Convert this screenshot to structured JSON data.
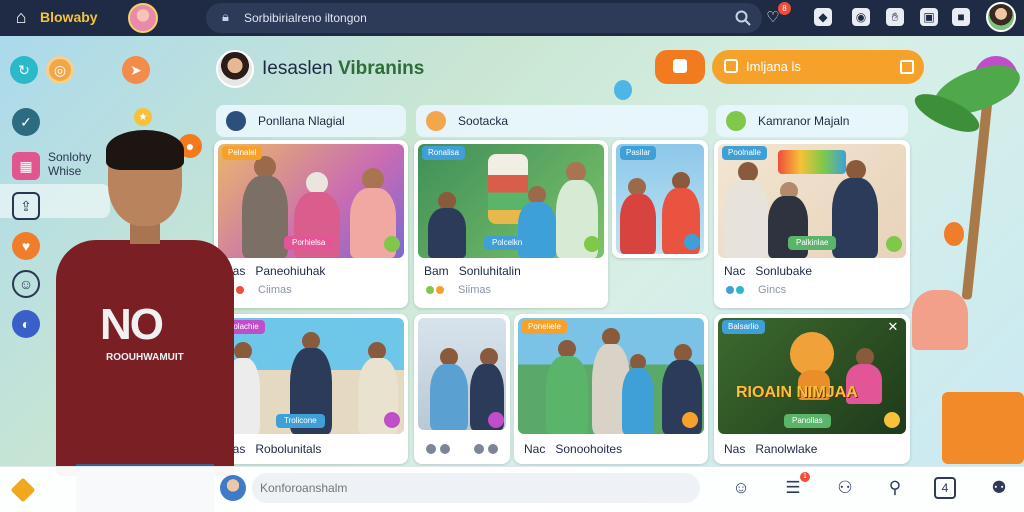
{
  "topbar": {
    "brand": "Blowaby",
    "search_text": "Sorbibirialreno iltongon",
    "notif_count": "8"
  },
  "sidebar": {
    "row_label": "Sonlohy Whise"
  },
  "main": {
    "title_plain": "Iesaslen",
    "title_highlight": "Vibranins",
    "pill_label": "Imljana ls"
  },
  "person": {
    "shirt_text": "NO",
    "shirt_sub": "ROOUHWAMUIT"
  },
  "columns": [
    {
      "label": "Ponllana Nlagial"
    },
    {
      "label": "Sootacka"
    },
    {
      "label": "Kamranor Majaln"
    }
  ],
  "cards": [
    {
      "tag": "Pelnalel",
      "ribbon": "Porhielsa",
      "t1a": "Nas",
      "t1b": "Paneohiuhak",
      "t2": "Ciimas"
    },
    {
      "tag": "Ronalisa",
      "ribbon": "Polcelkn",
      "t1a": "Bam",
      "t1b": "Sonluhitalin",
      "t2": "Siimas"
    },
    {
      "tag": "Pasilar",
      "ribbon": "",
      "t1a": "",
      "t1b": "",
      "t2": ""
    },
    {
      "tag": "Poolnalle",
      "ribbon": "Palkinlae",
      "t1a": "Nac",
      "t1b": "Sonlubake",
      "t2": "Gincs"
    },
    {
      "tag": "Polachie",
      "ribbon": "Trolicone",
      "t1a": "Nas",
      "t1b": "Robolunitals",
      "t2": ""
    },
    {
      "tag": "",
      "ribbon": "",
      "t1a": "",
      "t1b": "",
      "t2": ""
    },
    {
      "tag": "Poneliele",
      "ribbon": "",
      "t1a": "Nac",
      "t1b": "Sonoohoites",
      "t2": ""
    },
    {
      "tag": "Balsarlio",
      "ribbon": "Panollas",
      "t1a": "Nas",
      "t1b": "Ranolwlake",
      "t2": "",
      "banner": "RIOAIN NIMJAA"
    }
  ],
  "bottombar": {
    "comment_placeholder": "Konforoanshalm",
    "badge_count": "1"
  }
}
